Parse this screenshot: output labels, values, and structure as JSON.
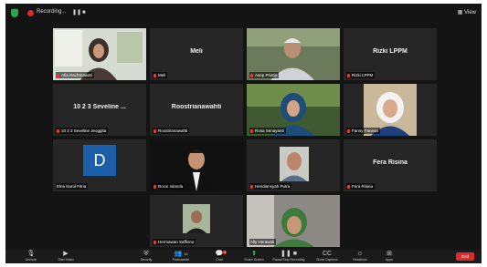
{
  "topbar": {
    "recording_label": "Recording...",
    "view_label": "View"
  },
  "tiles": [
    {
      "name": "Afia Rachmawati"
    },
    {
      "name": "Meli",
      "big": "Meli"
    },
    {
      "name": "Asep Priatin"
    },
    {
      "name": "Rizki LPPM",
      "big": "Rizki LPPM"
    },
    {
      "name": "10 2 3 Seveline Jeoggita",
      "big": "10 2 3 Seveline ..."
    },
    {
      "name": "Roostrianawahti",
      "big": "Roostrianawahti"
    },
    {
      "name": "Rosa Senayanti"
    },
    {
      "name": "Fanny Fanesa"
    },
    {
      "name": "Elna Nurul Fitria",
      "avatar": "D"
    },
    {
      "name": "Rocsi Iolanda"
    },
    {
      "name": "Hendiansyah Putra"
    },
    {
      "name": "Fera Risina",
      "big": "Fera Risina"
    },
    {
      "name": "Hermawan Saffiono"
    },
    {
      "name": "Ally Herawati"
    }
  ],
  "toolbar": {
    "unmute": "Unmute",
    "start_video": "Start Video",
    "security": "Security",
    "participants": "Participants",
    "participants_count": "14",
    "chat": "Chat",
    "chat_badge": "2",
    "share_screen": "Share Screen",
    "pause_recording": "Pause/Stop Recording",
    "show_captions": "Show Captions",
    "reactions": "Reactions",
    "apps": "Apps",
    "end": "End"
  },
  "colors": {
    "active_speaker": "#f2d646",
    "end_button": "#e02828",
    "share_green": "#2fbf5b",
    "avatar_blue": "#1c5fa8"
  }
}
